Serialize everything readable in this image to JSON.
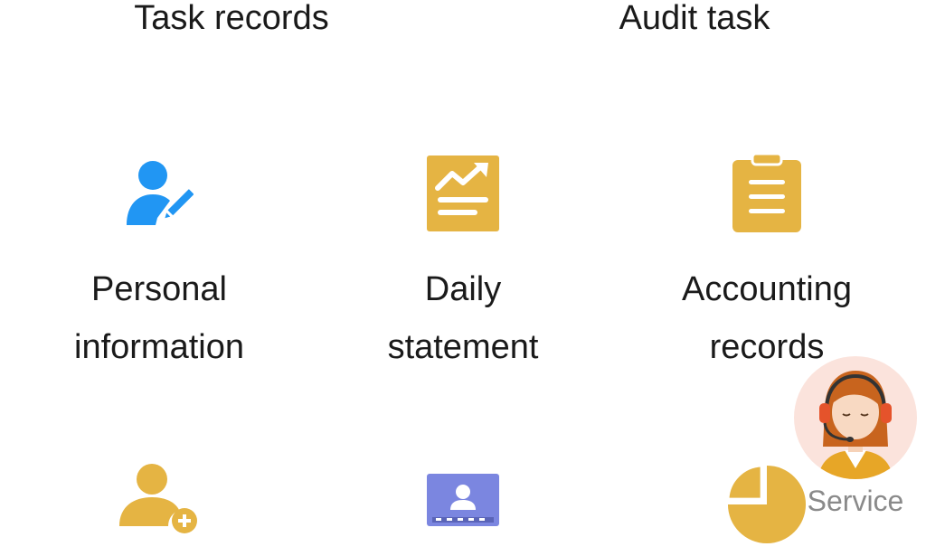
{
  "header": {
    "left_label": "Task records",
    "right_label": "Audit task"
  },
  "grid": {
    "items": [
      {
        "label": "Personal information",
        "icon": "user-edit-icon",
        "color": "#2196F3"
      },
      {
        "label": "Daily statement",
        "icon": "chart-trend-icon",
        "color": "#E5B443"
      },
      {
        "label": "Accounting records",
        "icon": "clipboard-icon",
        "color": "#E5B443"
      },
      {
        "label": "",
        "icon": "user-add-icon",
        "color": "#E5B443"
      },
      {
        "label": "",
        "icon": "monitor-user-icon",
        "color": "#7B86E0"
      },
      {
        "label": "",
        "icon": "pie-chart-icon",
        "color": "#E5B443"
      }
    ]
  },
  "service": {
    "label": "Service",
    "icon": "customer-service-avatar-icon",
    "avatar_bg": "#FBE3DC"
  }
}
